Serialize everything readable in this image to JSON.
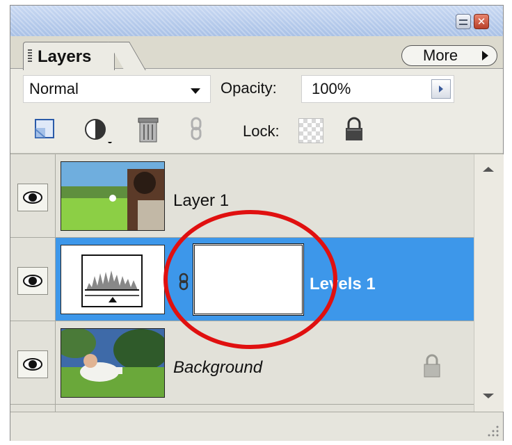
{
  "panel": {
    "tab_label": "Layers",
    "more_label": "More",
    "window_buttons": {
      "minimize_icon": "minimize-icon",
      "close_icon": "close-icon",
      "close_glyph": "✕"
    }
  },
  "controls": {
    "blend_mode": "Normal",
    "opacity_label": "Opacity:",
    "opacity_value": "100%",
    "lock_label": "Lock:"
  },
  "toolbar": {
    "icons": [
      "new-layer-icon",
      "adjustment-layer-icon",
      "trash-icon",
      "link-icon",
      "lock-transparency-icon",
      "lock-icon"
    ]
  },
  "layers": [
    {
      "name": "Layer 1",
      "thumbnail": "photo-girl-dandelion",
      "selected": false,
      "visible": true
    },
    {
      "name": "Levels 1",
      "thumbnail": "levels-histogram",
      "mask": "white-mask",
      "selected": true,
      "visible": true
    },
    {
      "name": "Background",
      "thumbnail": "photo-woman-grass",
      "selected": false,
      "visible": true,
      "locked": true
    }
  ],
  "colors": {
    "selection": "#3d97ea",
    "annotation_ring": "#e01010",
    "panel_bg": "#ecebe4"
  }
}
